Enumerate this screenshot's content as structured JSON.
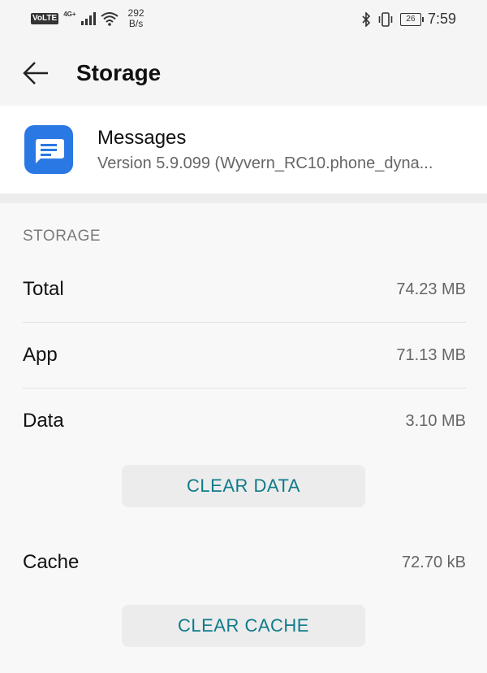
{
  "status_bar": {
    "volte": "VoLTE",
    "network": "4G+",
    "speed_value": "292",
    "speed_unit": "B/s",
    "battery": "26",
    "time": "7:59"
  },
  "toolbar": {
    "title": "Storage"
  },
  "app": {
    "name": "Messages",
    "version": "Version 5.9.099 (Wyvern_RC10.phone_dyna..."
  },
  "storage": {
    "section_label": "STORAGE",
    "rows": [
      {
        "label": "Total",
        "value": "74.23 MB"
      },
      {
        "label": "App",
        "value": "71.13 MB"
      },
      {
        "label": "Data",
        "value": "3.10 MB"
      }
    ],
    "clear_data_label": "CLEAR DATA",
    "cache_label": "Cache",
    "cache_value": "72.70 kB",
    "clear_cache_label": "CLEAR CACHE"
  },
  "colors": {
    "accent": "#0f7b8a",
    "app_icon": "#2a78e4"
  }
}
